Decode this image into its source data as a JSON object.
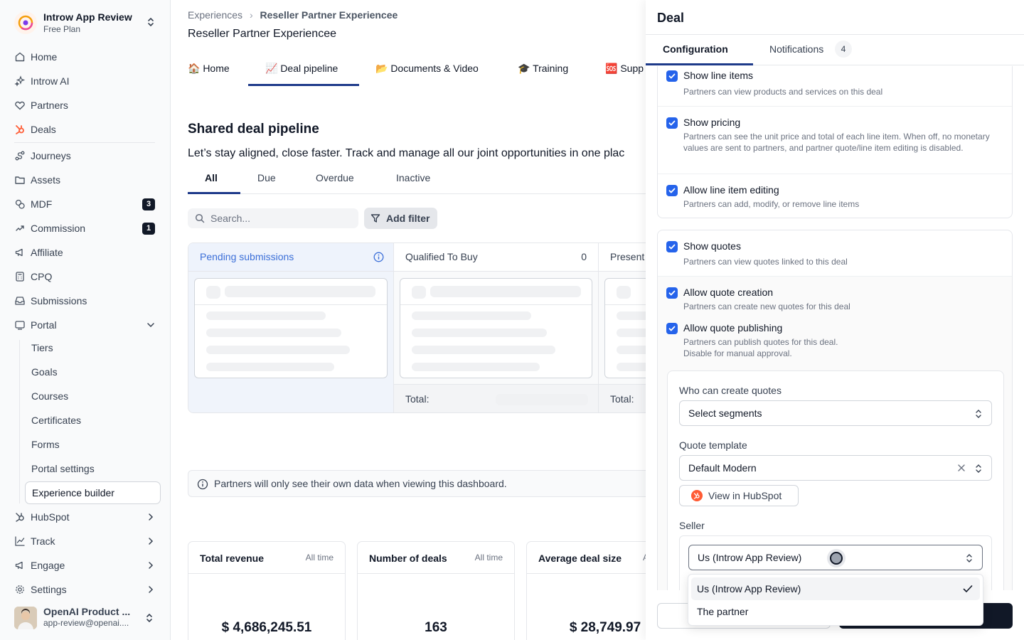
{
  "sidebar": {
    "workspace": {
      "name": "Introw App Review",
      "plan": "Free Plan"
    },
    "items": [
      {
        "label": "Home",
        "icon": "home-icon"
      },
      {
        "label": "Introw AI",
        "icon": "sparkle-icon"
      },
      {
        "label": "Partners",
        "icon": "handshake-icon"
      },
      {
        "label": "Deals",
        "icon": "hubspot-icon"
      },
      {
        "label": "Journeys",
        "icon": "journey-icon"
      },
      {
        "label": "Assets",
        "icon": "folder-icon"
      },
      {
        "label": "MDF",
        "icon": "coins-icon",
        "count": "3"
      },
      {
        "label": "Commission",
        "icon": "commission-icon",
        "count": "1"
      },
      {
        "label": "Affiliate",
        "icon": "megaphone-icon"
      },
      {
        "label": "CPQ",
        "icon": "calculator-icon"
      },
      {
        "label": "Submissions",
        "icon": "inbox-icon"
      },
      {
        "label": "Portal",
        "icon": "portal-icon"
      }
    ],
    "portal_sub": [
      "Tiers",
      "Goals",
      "Courses",
      "Certificates",
      "Forms",
      "Portal settings",
      "Experience builder"
    ],
    "bottom_items": [
      {
        "label": "HubSpot",
        "icon": "hubspot-icon"
      },
      {
        "label": "Track",
        "icon": "chart-icon"
      },
      {
        "label": "Engage",
        "icon": "megaphone-icon"
      },
      {
        "label": "Settings",
        "icon": "gear-icon"
      }
    ],
    "user": {
      "name": "OpenAI Product ...",
      "email": "app-review@openai...."
    }
  },
  "main": {
    "breadcrumb": {
      "parent": "Experiences",
      "current": "Reseller Partner Experiencee"
    },
    "title": "Reseller Partner Experiencee",
    "tabs": [
      "🏠 Home",
      "📈 Deal pipeline",
      "📂 Documents & Video",
      "🎓 Training",
      "🆘 Supp"
    ],
    "section_title": "Shared deal pipeline",
    "section_subtitle": "Let’s stay aligned, close faster. Track and manage all our joint opportunities in one plac",
    "filter_tabs": [
      "All",
      "Due",
      "Overdue",
      "Inactive"
    ],
    "search_placeholder": "Search...",
    "add_filter": "Add filter",
    "columns": [
      {
        "title": "Pending submissions"
      },
      {
        "title": "Qualified To Buy",
        "count": "0",
        "total": "Total:"
      },
      {
        "title": "Present",
        "total": "Total:"
      }
    ],
    "notice": "Partners will only see their own data when viewing this dashboard.",
    "stats": [
      {
        "title": "Total revenue",
        "range": "All time",
        "value": "$ 4,686,245.51"
      },
      {
        "title": "Number of deals",
        "range": "All time",
        "value": "163"
      },
      {
        "title": "Average deal size",
        "range": "A",
        "value": "$ 28,749.97"
      }
    ]
  },
  "panel": {
    "title": "Deal",
    "tabs": {
      "configuration": "Configuration",
      "notifications": "Notifications",
      "notifications_count": "4"
    },
    "line_items": [
      {
        "title": "Show line items",
        "desc": "Partners can view products and services on this deal"
      },
      {
        "title": "Show pricing",
        "desc": "Partners can see the unit price and total of each line item. When off, no monetary values are sent to partners, and partner quote/line item editing is disabled."
      },
      {
        "title": "Allow line item editing",
        "desc": "Partners can add, modify, or remove line items"
      }
    ],
    "quotes": [
      {
        "title": "Show quotes",
        "desc": "Partners can view quotes linked to this deal"
      },
      {
        "title": "Allow quote creation",
        "desc": "Partners can create new quotes for this deal"
      },
      {
        "title": "Allow quote publishing",
        "desc": "Partners can publish quotes for this deal.\nDisable for manual approval."
      }
    ],
    "who_label": "Who can create quotes",
    "who_value": "Select segments",
    "template_label": "Quote template",
    "template_value": "Default Modern",
    "view_hubspot": "View in HubSpot",
    "seller_label": "Seller",
    "seller_value": "Us (Introw App Review)",
    "seller_options": [
      "Us (Introw App Review)",
      "The partner"
    ]
  }
}
